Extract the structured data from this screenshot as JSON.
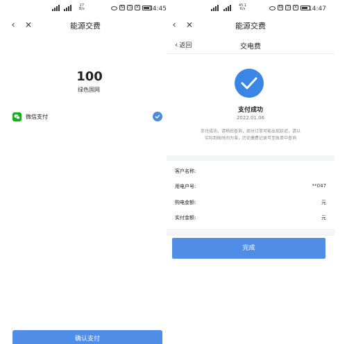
{
  "left": {
    "statusbar": {
      "speed": "27\nB/s",
      "time": "14:45"
    },
    "nav": {
      "back_icon": "chevron-left",
      "close_icon": "close",
      "title": "能源交费"
    },
    "amount": "100",
    "payee": "绿色国网",
    "payment_method": {
      "label": "微信支付",
      "icon": "wechat-pay",
      "selected": true
    },
    "confirm_button": "确认支付"
  },
  "right": {
    "statusbar": {
      "speed": "45.1\nK/s",
      "time": "14:47"
    },
    "nav": {
      "back_icon": "chevron-left",
      "close_icon": "close",
      "title": "能源交费"
    },
    "subnav": {
      "back_label": "返回",
      "title": "交电费"
    },
    "success": {
      "title": "支付成功",
      "date": "2022.01.06",
      "notice_line1": "支付成功，请稍后查询，部分订单可能出现延迟，请以",
      "notice_line2": "实际到账时间为准，历史缴费记录可至账单中查询"
    },
    "details": [
      {
        "label": "客户名称:",
        "value": ""
      },
      {
        "label": "用电户号:",
        "value": "**047"
      },
      {
        "label": "购电金额:",
        "value": "元"
      },
      {
        "label": "实付金额:",
        "value": "元"
      }
    ],
    "done_button": "完成"
  },
  "colors": {
    "accent": "#4f8de6",
    "wechat_green": "#1aad19",
    "success_blue": "#3a86e4"
  }
}
